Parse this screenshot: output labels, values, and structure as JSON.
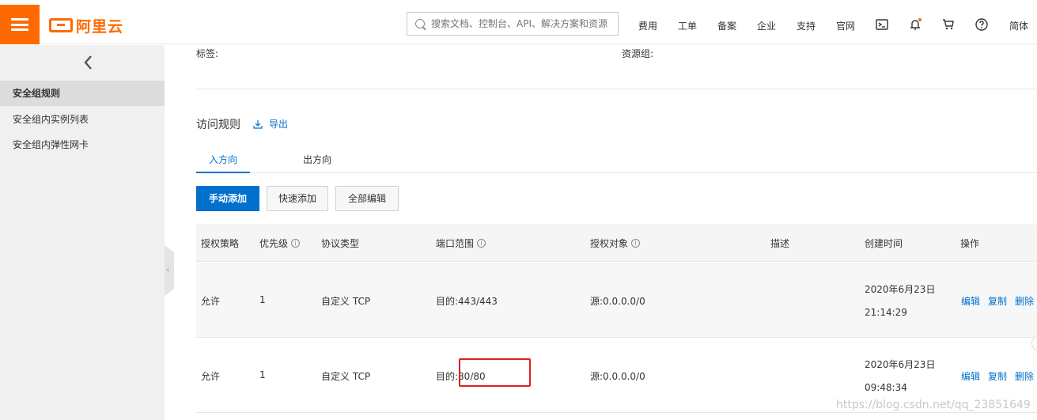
{
  "header": {
    "logo_text": "阿里云",
    "search_placeholder": "搜索文档、控制台、API、解决方案和资源",
    "nav": [
      "费用",
      "工单",
      "备案",
      "企业",
      "支持",
      "官网"
    ],
    "lang": "简体",
    "icons": [
      "terminal-icon",
      "bell-icon",
      "cart-icon",
      "help-icon"
    ],
    "accent": "#ff6a00"
  },
  "sidebar": {
    "items": [
      {
        "label": "安全组规则",
        "active": true
      },
      {
        "label": "安全组内实例列表",
        "active": false
      },
      {
        "label": "安全组内弹性网卡",
        "active": false
      }
    ]
  },
  "main": {
    "tags_label": "标签:",
    "resource_group_label": "资源组:",
    "section_title": "访问规则",
    "export_label": "导出",
    "tabs": [
      "入方向",
      "出方向"
    ],
    "buttons": {
      "manual_add": "手动添加",
      "quick_add": "快速添加",
      "edit_all": "全部编辑"
    },
    "columns": [
      "授权策略",
      "优先级",
      "协议类型",
      "端口范围",
      "授权对象",
      "描述",
      "创建时间",
      "操作"
    ],
    "rows": [
      {
        "policy": "允许",
        "priority": "1",
        "protocol": "自定义 TCP",
        "port": "目的:443/443",
        "object": "源:0.0.0.0/0",
        "desc": "",
        "date": "2020年6月23日",
        "time": "21:14:29"
      },
      {
        "policy": "允许",
        "priority": "1",
        "protocol": "自定义 TCP",
        "port": "目的:80/80",
        "object": "源:0.0.0.0/0",
        "desc": "",
        "date": "2020年6月23日",
        "time": "09:48:34"
      }
    ],
    "actions": {
      "edit": "编辑",
      "copy": "复制",
      "delete": "删除"
    },
    "link_color": "#0070cc"
  },
  "watermark": "https://blog.csdn.net/qq_23851649"
}
